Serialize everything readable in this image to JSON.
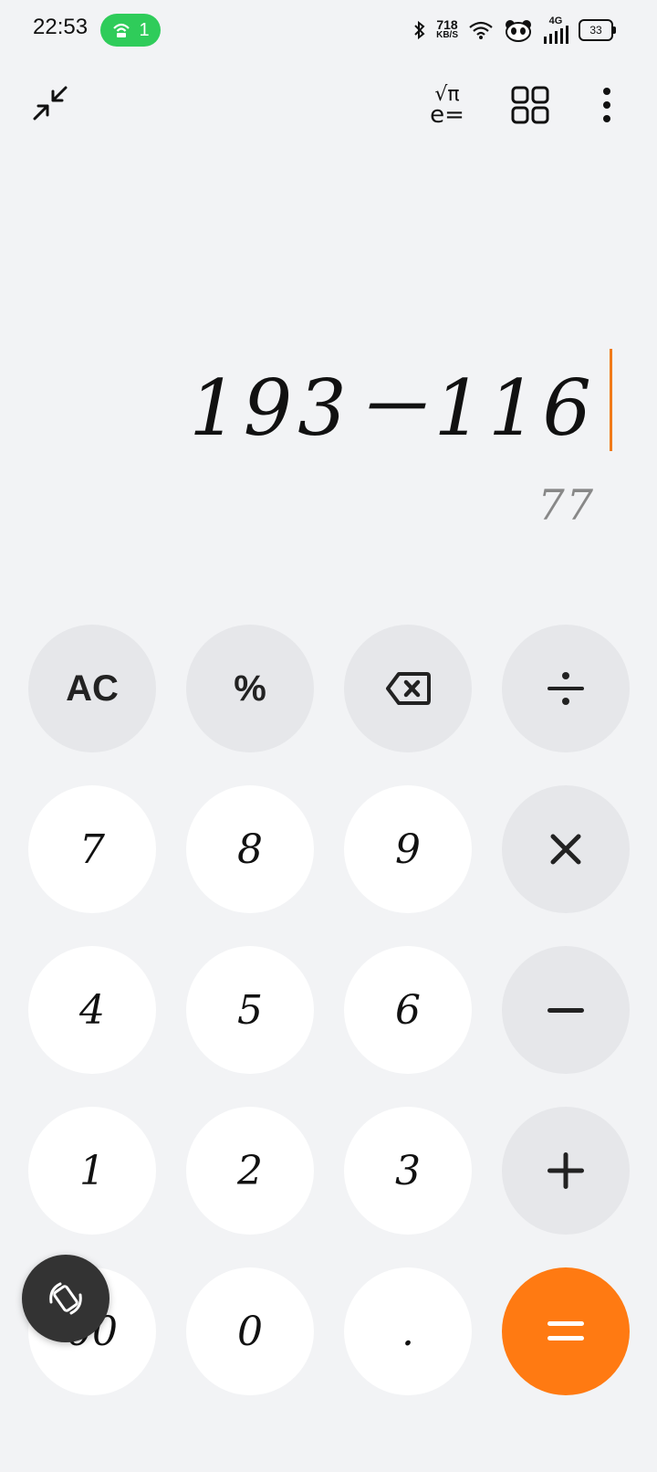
{
  "status_bar": {
    "time": "22:53",
    "hotspot_count": "1",
    "net_speed_value": "718",
    "net_speed_unit": "KB/S",
    "network_label": "4G",
    "battery": "33"
  },
  "toolbar": {
    "collapse_icon": "collapse-arrows-icon",
    "scientific_icon": "scientific-functions-icon",
    "scientific_top": "√π",
    "scientific_bottom": "e=",
    "grid_icon": "grid-icon",
    "menu_icon": "more-vertical-icon"
  },
  "display": {
    "expression": "193－116",
    "result": "77",
    "cursor_color": "#f07a1a"
  },
  "keypad": {
    "ac": "AC",
    "percent": "%",
    "backspace_icon": "backspace-icon",
    "divide": "÷",
    "multiply": "×",
    "minus": "−",
    "plus": "+",
    "equals": "=",
    "seven": "7",
    "eight": "8",
    "nine": "9",
    "four": "4",
    "five": "5",
    "six": "6",
    "one": "1",
    "two": "2",
    "three": "3",
    "double_zero": "00",
    "zero": "0",
    "dot": "."
  },
  "floating_button": {
    "icon": "rotate-screen-icon"
  },
  "colors": {
    "accent": "#ff7a12",
    "background": "#f2f3f5",
    "operator_key": "#e6e7ea",
    "number_key": "#ffffff"
  }
}
